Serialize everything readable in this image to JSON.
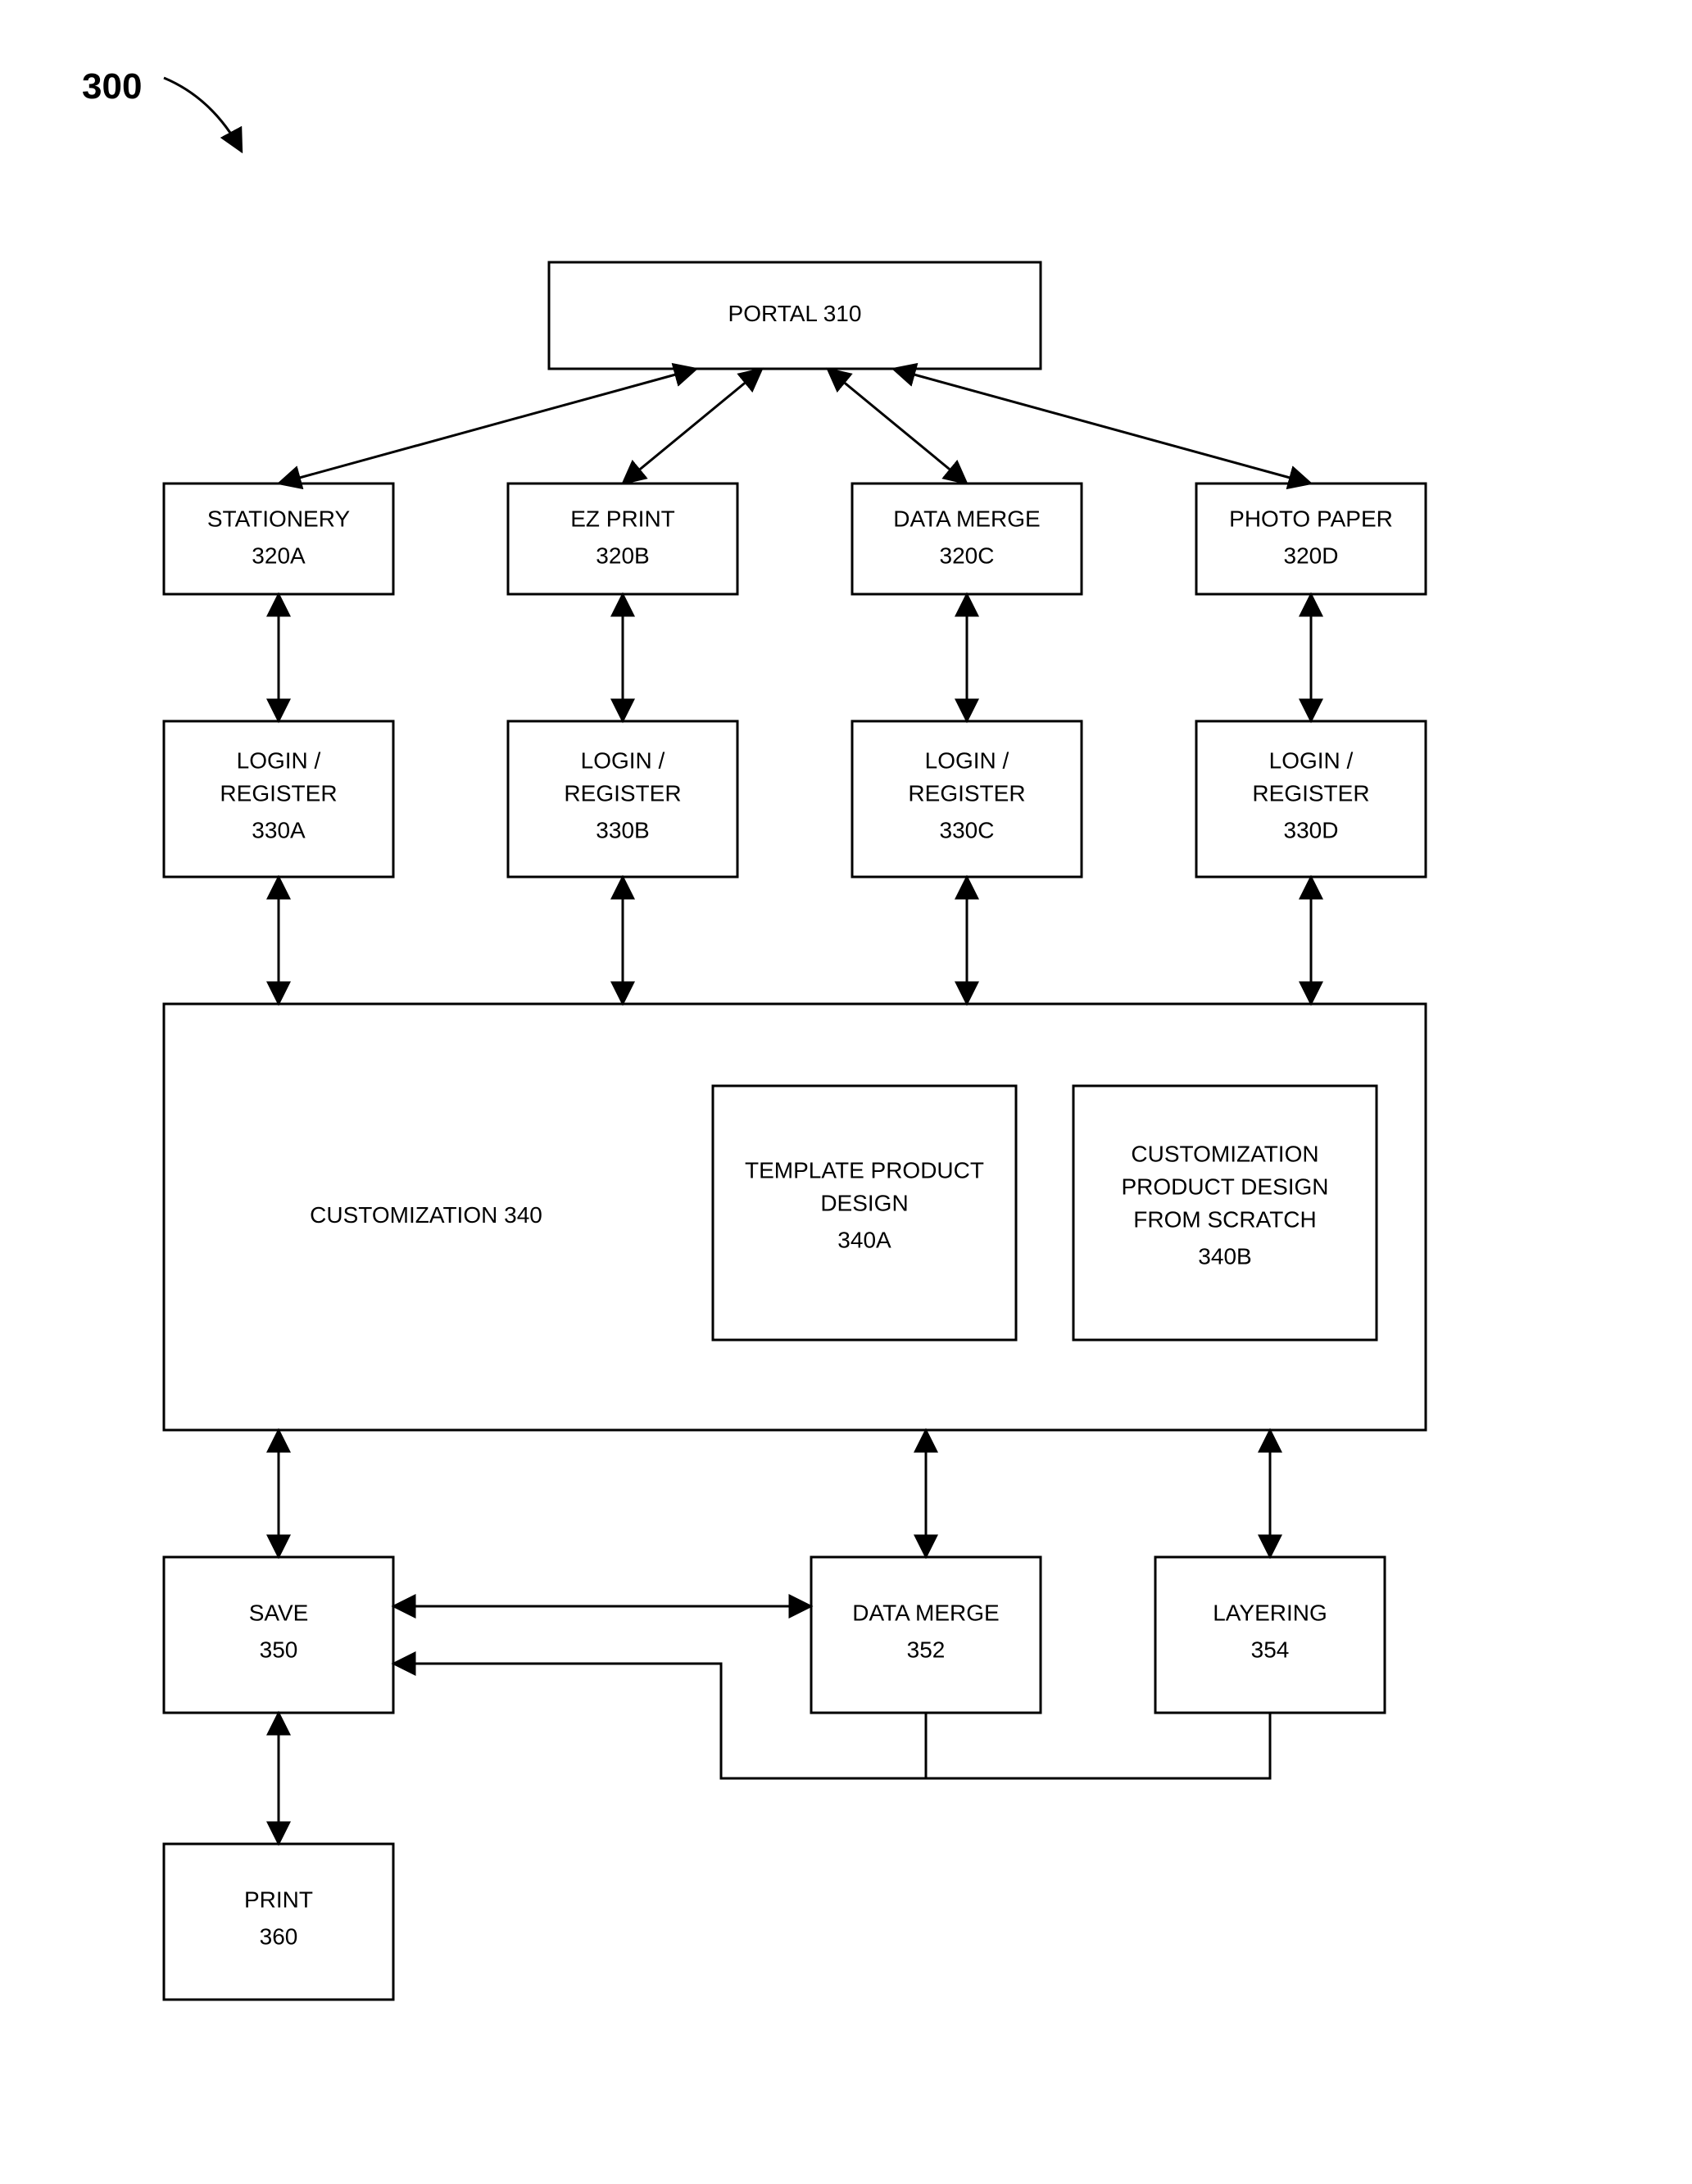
{
  "figure_number": "300",
  "portal": {
    "label": "PORTAL",
    "id": "310"
  },
  "stationery": {
    "label": "STATIONERY",
    "id": "320A"
  },
  "ezprint": {
    "label": "EZ PRINT",
    "id": "320B"
  },
  "datamerge_top": {
    "label": "DATA MERGE",
    "id": "320C"
  },
  "photopaper": {
    "label": "PHOTO PAPER",
    "id": "320D"
  },
  "login_a": {
    "label1": "LOGIN /",
    "label2": "REGISTER",
    "id": "330A"
  },
  "login_b": {
    "label1": "LOGIN /",
    "label2": "REGISTER",
    "id": "330B"
  },
  "login_c": {
    "label1": "LOGIN /",
    "label2": "REGISTER",
    "id": "330C"
  },
  "login_d": {
    "label1": "LOGIN /",
    "label2": "REGISTER",
    "id": "330D"
  },
  "customization": {
    "label": "CUSTOMIZATION",
    "id": "340"
  },
  "template": {
    "label1": "TEMPLATE PRODUCT",
    "label2": "DESIGN",
    "id": "340A"
  },
  "scratch": {
    "label1": "CUSTOMIZATION",
    "label2": "PRODUCT DESIGN",
    "label3": "FROM SCRATCH",
    "id": "340B"
  },
  "save": {
    "label": "SAVE",
    "id": "350"
  },
  "datamerge": {
    "label": "DATA MERGE",
    "id": "352"
  },
  "layering": {
    "label": "LAYERING",
    "id": "354"
  },
  "print": {
    "label": "PRINT",
    "id": "360"
  }
}
